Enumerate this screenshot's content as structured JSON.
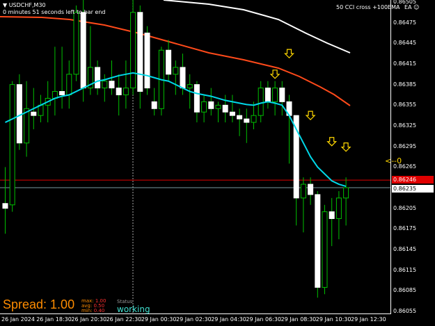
{
  "header": {
    "symbol": "USDCHF,M30",
    "timer": "0 minutes 51 seconds left to bar end",
    "indicator": "50 CCI cross +100EMA",
    "ea_label": "EA"
  },
  "price_axis": {
    "ticks": [
      "0.86505",
      "0.86475",
      "0.86445",
      "0.86415",
      "0.86385",
      "0.86355",
      "0.86325",
      "0.86295",
      "0.86265",
      "0.86235",
      "0.86205",
      "0.86175",
      "0.86145",
      "0.86115",
      "0.86085",
      "0.86055"
    ],
    "red_label": "0.86246",
    "bid_label": "0.86235"
  },
  "time_axis": {
    "ticks": [
      "26 Jan 2024",
      "26 Jan 18:30",
      "26 Jan 20:30",
      "26 Jan 22:30",
      "29 Jan 00:30",
      "29 Jan 02:30",
      "29 Jan 04:30",
      "29 Jan 06:30",
      "29 Jan 08:30",
      "29 Jan 10:30",
      "29 Jan 12:30"
    ]
  },
  "overlay": {
    "spread_text": "Spread: 1.00",
    "stats": [
      {
        "label": "max:",
        "value": "1.00"
      },
      {
        "label": "avg:",
        "value": "0.50"
      },
      {
        "label": "min:",
        "value": "0.40"
      }
    ],
    "status_label": "Status",
    "status_value": "working",
    "right_indicator": "<--0"
  },
  "colors": {
    "bull": "#ffffff",
    "bear": "#ffffff",
    "wick": "#00c000",
    "ema_fast": "#00d8e8",
    "ema_slow": "#ff4a1a",
    "ema_white": "#ffffff",
    "arrow": "#ffd700",
    "red_line": "#e00000",
    "bid_line": "#7a9aa0",
    "spread": "#ff8c00",
    "status": "#40e0d0"
  },
  "chart_data": {
    "type": "candlestick",
    "candles": [
      {
        "o": 0.86212,
        "h": 0.86265,
        "l": 0.86168,
        "c": 0.86205
      },
      {
        "o": 0.8621,
        "h": 0.8639,
        "l": 0.862,
        "c": 0.86385
      },
      {
        "o": 0.86385,
        "h": 0.864,
        "l": 0.8629,
        "c": 0.863
      },
      {
        "o": 0.863,
        "h": 0.8639,
        "l": 0.8628,
        "c": 0.8635
      },
      {
        "o": 0.86345,
        "h": 0.8638,
        "l": 0.8632,
        "c": 0.8634
      },
      {
        "o": 0.8634,
        "h": 0.8637,
        "l": 0.8633,
        "c": 0.86355
      },
      {
        "o": 0.86355,
        "h": 0.8639,
        "l": 0.8633,
        "c": 0.86365
      },
      {
        "o": 0.86365,
        "h": 0.8644,
        "l": 0.8634,
        "c": 0.86375
      },
      {
        "o": 0.86375,
        "h": 0.8644,
        "l": 0.8635,
        "c": 0.8637
      },
      {
        "o": 0.8637,
        "h": 0.8642,
        "l": 0.8635,
        "c": 0.864
      },
      {
        "o": 0.864,
        "h": 0.865,
        "l": 0.8639,
        "c": 0.8649
      },
      {
        "o": 0.8649,
        "h": 0.8651,
        "l": 0.8636,
        "c": 0.8638
      },
      {
        "o": 0.8638,
        "h": 0.8647,
        "l": 0.8637,
        "c": 0.8641
      },
      {
        "o": 0.8641,
        "h": 0.8642,
        "l": 0.8637,
        "c": 0.8638
      },
      {
        "o": 0.8638,
        "h": 0.864,
        "l": 0.8636,
        "c": 0.8639
      },
      {
        "o": 0.8639,
        "h": 0.8642,
        "l": 0.8637,
        "c": 0.8638
      },
      {
        "o": 0.8638,
        "h": 0.864,
        "l": 0.8634,
        "c": 0.8637
      },
      {
        "o": 0.8637,
        "h": 0.8642,
        "l": 0.8635,
        "c": 0.8638
      },
      {
        "o": 0.8638,
        "h": 0.8651,
        "l": 0.8637,
        "c": 0.8649
      },
      {
        "o": 0.8649,
        "h": 0.865,
        "l": 0.8635,
        "c": 0.86375
      },
      {
        "o": 0.8646,
        "h": 0.8647,
        "l": 0.8637,
        "c": 0.8638
      },
      {
        "o": 0.8636,
        "h": 0.8638,
        "l": 0.8634,
        "c": 0.8635
      },
      {
        "o": 0.8635,
        "h": 0.8644,
        "l": 0.8634,
        "c": 0.86435
      },
      {
        "o": 0.86435,
        "h": 0.8645,
        "l": 0.8639,
        "c": 0.864
      },
      {
        "o": 0.864,
        "h": 0.8642,
        "l": 0.8637,
        "c": 0.8641
      },
      {
        "o": 0.8641,
        "h": 0.8643,
        "l": 0.8637,
        "c": 0.8638
      },
      {
        "o": 0.8638,
        "h": 0.864,
        "l": 0.8635,
        "c": 0.86385
      },
      {
        "o": 0.86385,
        "h": 0.8639,
        "l": 0.8633,
        "c": 0.86345
      },
      {
        "o": 0.86345,
        "h": 0.8637,
        "l": 0.8633,
        "c": 0.8636
      },
      {
        "o": 0.8636,
        "h": 0.8638,
        "l": 0.8634,
        "c": 0.8635
      },
      {
        "o": 0.8635,
        "h": 0.8636,
        "l": 0.8633,
        "c": 0.86355
      },
      {
        "o": 0.86355,
        "h": 0.8637,
        "l": 0.8633,
        "c": 0.86345
      },
      {
        "o": 0.86345,
        "h": 0.8637,
        "l": 0.8633,
        "c": 0.8634
      },
      {
        "o": 0.8634,
        "h": 0.8635,
        "l": 0.8631,
        "c": 0.86335
      },
      {
        "o": 0.86335,
        "h": 0.8635,
        "l": 0.863,
        "c": 0.8633
      },
      {
        "o": 0.8633,
        "h": 0.8636,
        "l": 0.8632,
        "c": 0.8634
      },
      {
        "o": 0.8634,
        "h": 0.8639,
        "l": 0.8633,
        "c": 0.8638
      },
      {
        "o": 0.8638,
        "h": 0.8639,
        "l": 0.8635,
        "c": 0.8636
      },
      {
        "o": 0.8636,
        "h": 0.8639,
        "l": 0.8634,
        "c": 0.8638
      },
      {
        "o": 0.8638,
        "h": 0.8639,
        "l": 0.8634,
        "c": 0.8636
      },
      {
        "o": 0.8636,
        "h": 0.8637,
        "l": 0.8627,
        "c": 0.8634
      },
      {
        "o": 0.8634,
        "h": 0.8634,
        "l": 0.8618,
        "c": 0.8622
      },
      {
        "o": 0.8622,
        "h": 0.8625,
        "l": 0.8617,
        "c": 0.8624
      },
      {
        "o": 0.8624,
        "h": 0.8625,
        "l": 0.8621,
        "c": 0.86225
      },
      {
        "o": 0.86225,
        "h": 0.8623,
        "l": 0.86075,
        "c": 0.8609
      },
      {
        "o": 0.8609,
        "h": 0.8621,
        "l": 0.8608,
        "c": 0.862
      },
      {
        "o": 0.862,
        "h": 0.8622,
        "l": 0.8615,
        "c": 0.8619
      },
      {
        "o": 0.8619,
        "h": 0.8623,
        "l": 0.8616,
        "c": 0.8622
      },
      {
        "o": 0.8622,
        "h": 0.8625,
        "l": 0.8618,
        "c": 0.86235
      }
    ],
    "ema_fast": [
      0.8633,
      0.86335,
      0.8634,
      0.86345,
      0.8635,
      0.86355,
      0.8636,
      0.86365,
      0.86368,
      0.8637,
      0.86375,
      0.8638,
      0.86385,
      0.8639,
      0.86392,
      0.86395,
      0.86398,
      0.864,
      0.86402,
      0.864,
      0.86398,
      0.86395,
      0.86392,
      0.8639,
      0.86385,
      0.8638,
      0.86375,
      0.86372,
      0.8637,
      0.86368,
      0.86365,
      0.86362,
      0.8636,
      0.86358,
      0.86356,
      0.86355,
      0.86358,
      0.8636,
      0.86358,
      0.86355,
      0.8634,
      0.8632,
      0.863,
      0.8628,
      0.86265,
      0.86255,
      0.86245,
      0.8624,
      0.86237
    ],
    "ema_slow_visible": true,
    "arrows": [
      {
        "bar": 40,
        "price": 0.86428
      },
      {
        "bar": 38,
        "price": 0.86398
      },
      {
        "bar": 43,
        "price": 0.86338
      },
      {
        "bar": 46,
        "price": 0.863
      },
      {
        "bar": 48,
        "price": 0.86292
      }
    ],
    "ylim": [
      0.86052,
      0.86508
    ],
    "hlines": {
      "red": 0.86246,
      "bid": 0.86235
    }
  }
}
